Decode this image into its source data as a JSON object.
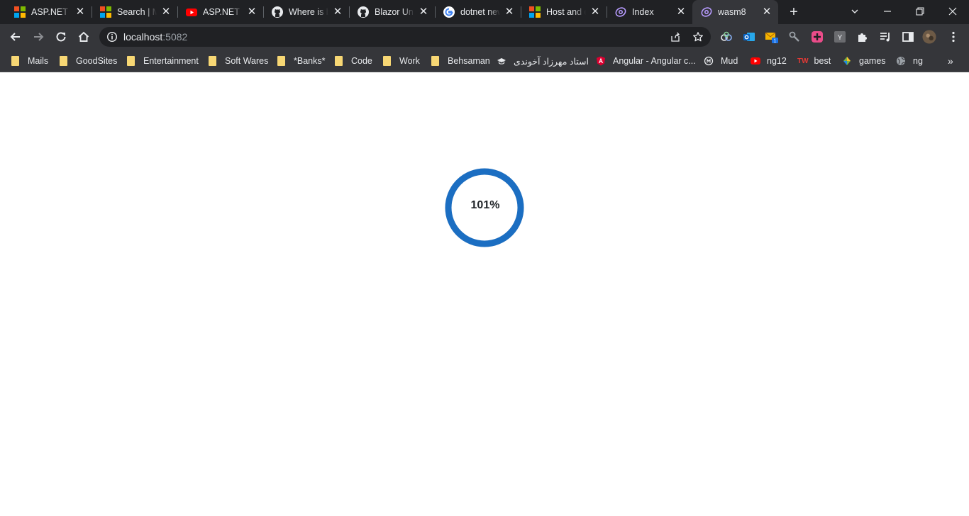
{
  "tabs": [
    {
      "title": "ASP.NET Core",
      "favicon": "microsoft-icon"
    },
    {
      "title": "Search | Microsoft",
      "favicon": "microsoft-icon"
    },
    {
      "title": "ASP.NET Core",
      "favicon": "youtube-icon"
    },
    {
      "title": "Where is blazor",
      "favicon": "github-icon"
    },
    {
      "title": "Blazor Unit",
      "favicon": "github-icon"
    },
    {
      "title": "dotnet new",
      "favicon": "google-icon"
    },
    {
      "title": "Host and deploy",
      "favicon": "microsoft-icon"
    },
    {
      "title": "Index",
      "favicon": "blazor-icon"
    },
    {
      "title": "wasm8",
      "favicon": "blazor-icon",
      "active": true
    }
  ],
  "address_bar": {
    "host": "localhost",
    "port": ":5082"
  },
  "bookmarks": [
    {
      "label": "Mails",
      "icon": "folder-icon"
    },
    {
      "label": "GoodSites",
      "icon": "folder-icon"
    },
    {
      "label": "Entertainment",
      "icon": "folder-icon"
    },
    {
      "label": "Soft Wares",
      "icon": "folder-icon"
    },
    {
      "label": "*Banks*",
      "icon": "folder-icon"
    },
    {
      "label": "Code",
      "icon": "folder-icon"
    },
    {
      "label": "Work",
      "icon": "folder-icon"
    },
    {
      "label": "Behsaman",
      "icon": "folder-icon"
    },
    {
      "label": "استاد مهرزاد آخوندی",
      "icon": "graduation-cap-icon"
    },
    {
      "label": "Angular - Angular c...",
      "icon": "angular-icon"
    },
    {
      "label": "Mud",
      "icon": "mud-icon"
    },
    {
      "label": "ng12",
      "icon": "youtube-icon"
    },
    {
      "label": "best",
      "icon": "tw-icon"
    },
    {
      "label": "games",
      "icon": "games-icon"
    },
    {
      "label": "ng",
      "icon": "globe-icon"
    }
  ],
  "loading": {
    "percent_text": "101%",
    "progress": 1.0,
    "ring_color": "#1b6ec2"
  },
  "colors": {
    "tab_strip": "#202124",
    "toolbar": "#35363a",
    "page": "#ffffff"
  }
}
